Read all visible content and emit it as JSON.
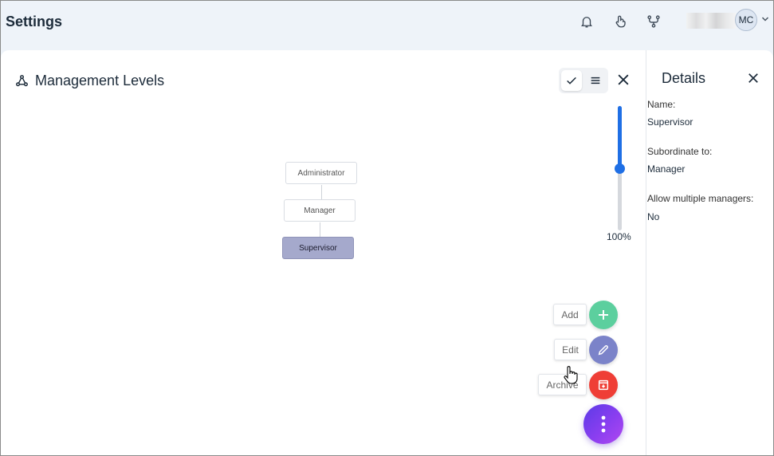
{
  "header": {
    "title": "Settings",
    "avatar_initials": "MC"
  },
  "panel": {
    "title": "Management Levels"
  },
  "zoom": {
    "label": "100%",
    "level": 0.5
  },
  "tree": {
    "nodes": [
      "Administrator",
      "Manager",
      "Supervisor"
    ],
    "selected": "Supervisor"
  },
  "actions": {
    "add_label": "Add",
    "edit_label": "Edit",
    "archive_label": "Archive",
    "add_color": "#5ccf9e",
    "edit_color": "#7b83c9",
    "archive_color": "#ef3e36"
  },
  "details": {
    "title": "Details",
    "name_label": "Name:",
    "name_value": "Supervisor",
    "subordinate_label": "Subordinate to:",
    "subordinate_value": "Manager",
    "multi_label": "Allow multiple managers:",
    "multi_value": "No"
  },
  "colors": {
    "accent": "#1f6fe5",
    "selected_node": "#a5a9cc"
  }
}
